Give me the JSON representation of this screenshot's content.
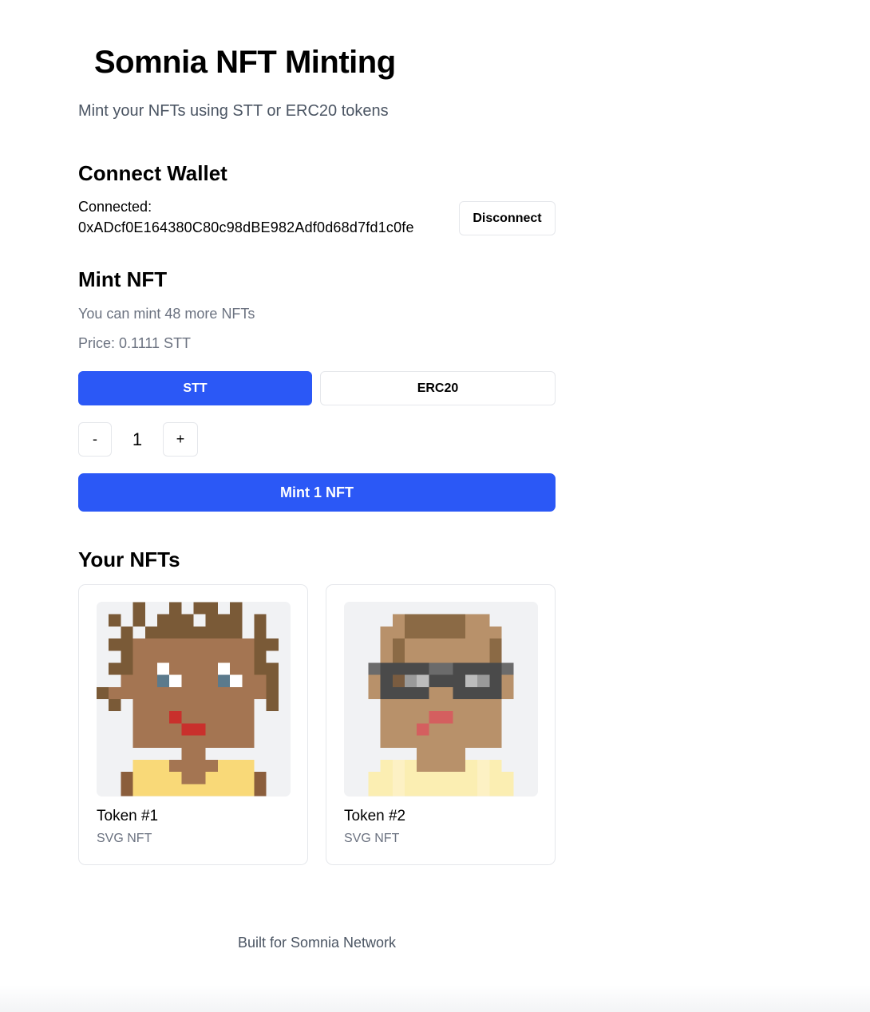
{
  "header": {
    "title": "Somnia NFT Minting",
    "subtitle": "Mint your NFTs using STT or ERC20 tokens"
  },
  "wallet": {
    "section_title": "Connect Wallet",
    "connected_label": "Connected:",
    "address": "0xADcf0E164380C80c98dBE982Adf0d68d7fd1c0fe",
    "disconnect_label": "Disconnect"
  },
  "mint": {
    "section_title": "Mint NFT",
    "remaining_text": "You can mint 48 more NFTs",
    "price_text": "Price: 0.1111 STT",
    "payment_options": [
      {
        "label": "STT",
        "selected": true
      },
      {
        "label": "ERC20",
        "selected": false
      }
    ],
    "decrement_label": "-",
    "increment_label": "+",
    "quantity": "1",
    "mint_button_label": "Mint 1 NFT"
  },
  "nfts": {
    "section_title": "Your NFTs",
    "items": [
      {
        "name": "Token #1",
        "type": "SVG NFT"
      },
      {
        "name": "Token #2",
        "type": "SVG NFT"
      }
    ]
  },
  "footer": {
    "text": "Built for Somnia Network"
  },
  "colors": {
    "primary": "#2b58f6",
    "border": "#e5e7eb",
    "muted_text": "#6b7280",
    "nft_background": "#f1f2f4"
  }
}
